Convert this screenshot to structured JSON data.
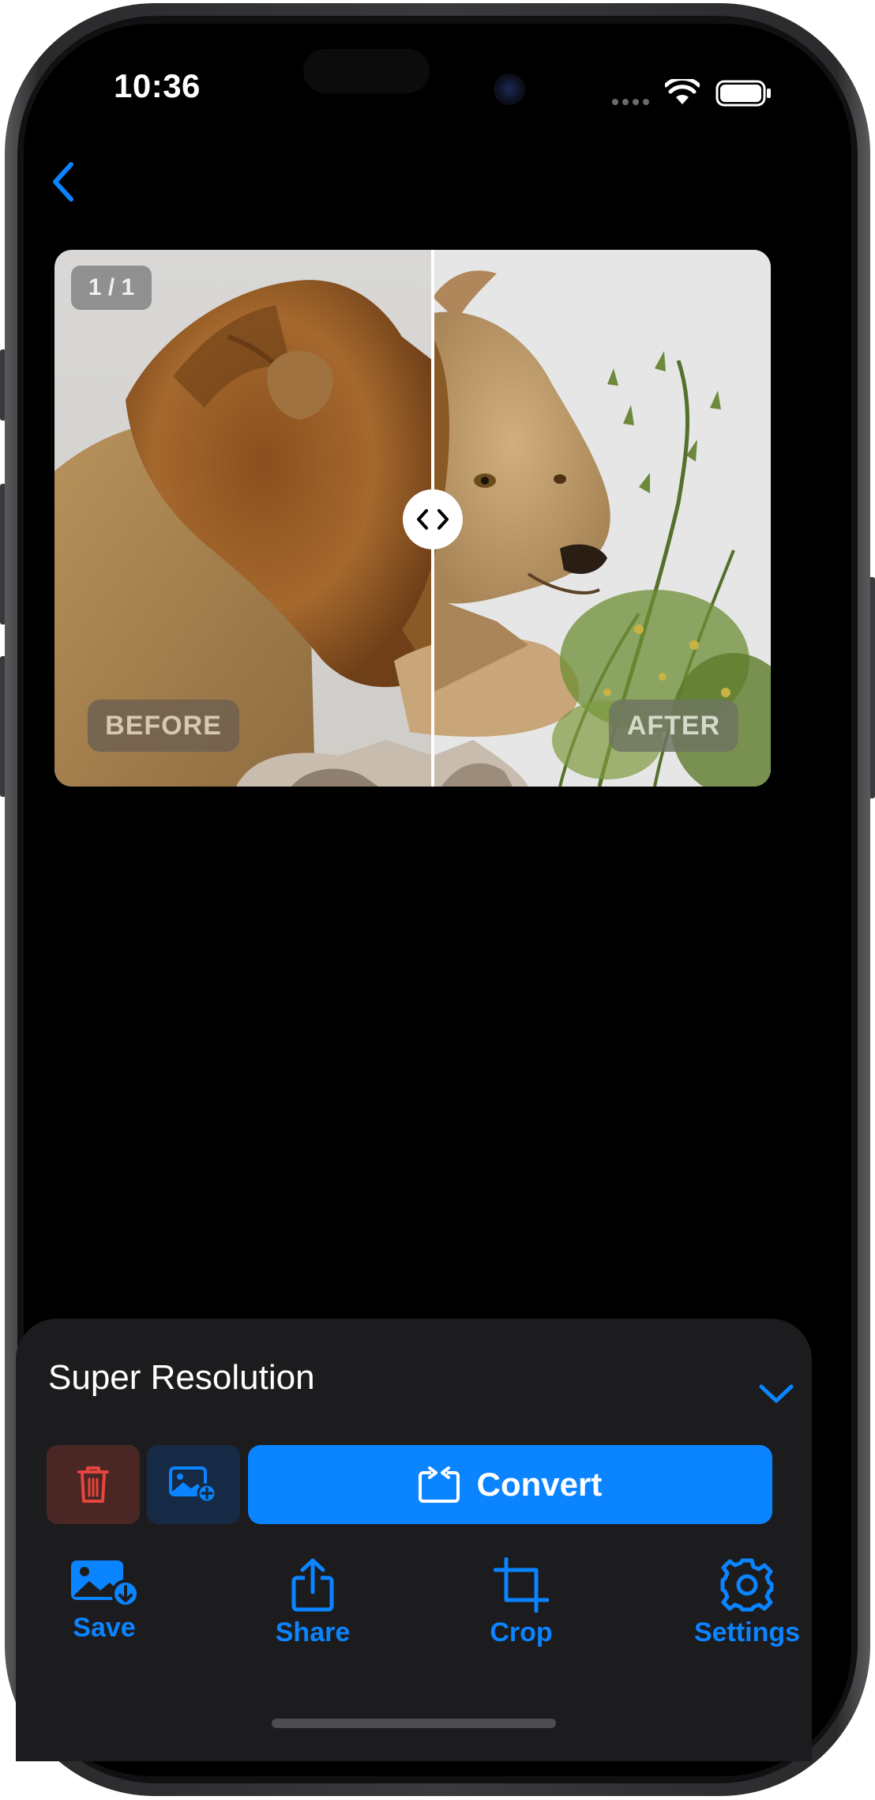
{
  "status_bar": {
    "time": "10:36"
  },
  "navigation": {
    "back_icon": "chevron-left-icon"
  },
  "compare": {
    "page_indicator": "1 / 1",
    "before_label": "BEFORE",
    "after_label": "AFTER",
    "slider_position": 0.53
  },
  "sheet": {
    "title": "Super Resolution",
    "collapse_icon": "chevron-down-icon",
    "convert_label": "Convert",
    "delete_icon": "trash-icon",
    "add_image_icon": "photo-add-icon",
    "tools": [
      {
        "label": "Save",
        "icon": "photo-download-icon"
      },
      {
        "label": "Share",
        "icon": "share-icon"
      },
      {
        "label": "Crop",
        "icon": "crop-icon"
      },
      {
        "label": "Settings",
        "icon": "gear-icon"
      }
    ]
  },
  "colors": {
    "accent": "#0a84ff",
    "delete_red": "#e5453c",
    "sheet_background": "#1c1c1e",
    "screen_background": "#000000"
  }
}
